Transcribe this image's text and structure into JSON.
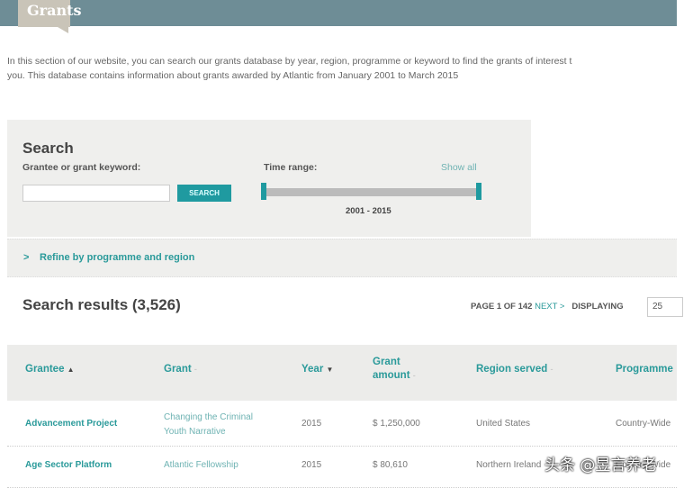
{
  "header": {
    "tab": "Grants"
  },
  "intro": {
    "line1": "In this section of our website, you can search our grants database by year, region, programme or keyword to find the grants of interest t",
    "line2": "you. This database contains information about grants awarded by Atlantic from January 2001 to March 2015"
  },
  "search": {
    "title": "Search",
    "keyword_label": "Grantee or grant keyword:",
    "keyword_value": "",
    "button": "SEARCH",
    "time_label": "Time range:",
    "show_all": "Show all",
    "range": "2001 - 2015"
  },
  "refine": {
    "arrow": ">",
    "label": "Refine by programme and region"
  },
  "results": {
    "title": "Search results (3,526)",
    "page": "PAGE 1 OF 142",
    "next": "NEXT >",
    "displaying": "DISPLAYING",
    "per_page": "25"
  },
  "table": {
    "headers": [
      {
        "label": "Grantee",
        "sort": "▲"
      },
      {
        "label": "Grant",
        "sort": "-"
      },
      {
        "label": "Year",
        "sort": "▼"
      },
      {
        "label": "Grant amount",
        "sort": "-"
      },
      {
        "label": "Region served",
        "sort": "-"
      },
      {
        "label": "Programme",
        "sort": ""
      }
    ],
    "rows": [
      {
        "grantee": "Advancement Project",
        "grant": "Changing the Criminal Youth Narrative",
        "year": "2015",
        "amount": "$ 1,250,000",
        "region": "United States",
        "programme": "Country-Wide"
      },
      {
        "grantee": "Age Sector Platform",
        "grant": "Atlantic Fellowship",
        "year": "2015",
        "amount": "$ 80,610",
        "region": "Northern Ireland",
        "programme": "Country-Wide"
      }
    ]
  },
  "watermark": "头条 @昱言养老"
}
